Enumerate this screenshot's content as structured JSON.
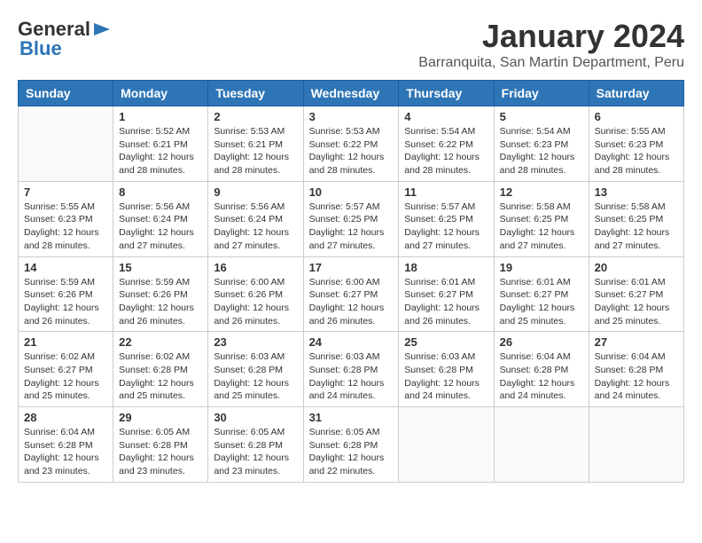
{
  "logo": {
    "general": "General",
    "blue": "Blue"
  },
  "title": "January 2024",
  "location": "Barranquita, San Martin Department, Peru",
  "headers": [
    "Sunday",
    "Monday",
    "Tuesday",
    "Wednesday",
    "Thursday",
    "Friday",
    "Saturday"
  ],
  "weeks": [
    [
      {
        "day": "",
        "info": ""
      },
      {
        "day": "1",
        "info": "Sunrise: 5:52 AM\nSunset: 6:21 PM\nDaylight: 12 hours\nand 28 minutes."
      },
      {
        "day": "2",
        "info": "Sunrise: 5:53 AM\nSunset: 6:21 PM\nDaylight: 12 hours\nand 28 minutes."
      },
      {
        "day": "3",
        "info": "Sunrise: 5:53 AM\nSunset: 6:22 PM\nDaylight: 12 hours\nand 28 minutes."
      },
      {
        "day": "4",
        "info": "Sunrise: 5:54 AM\nSunset: 6:22 PM\nDaylight: 12 hours\nand 28 minutes."
      },
      {
        "day": "5",
        "info": "Sunrise: 5:54 AM\nSunset: 6:23 PM\nDaylight: 12 hours\nand 28 minutes."
      },
      {
        "day": "6",
        "info": "Sunrise: 5:55 AM\nSunset: 6:23 PM\nDaylight: 12 hours\nand 28 minutes."
      }
    ],
    [
      {
        "day": "7",
        "info": "Sunrise: 5:55 AM\nSunset: 6:23 PM\nDaylight: 12 hours\nand 28 minutes."
      },
      {
        "day": "8",
        "info": "Sunrise: 5:56 AM\nSunset: 6:24 PM\nDaylight: 12 hours\nand 27 minutes."
      },
      {
        "day": "9",
        "info": "Sunrise: 5:56 AM\nSunset: 6:24 PM\nDaylight: 12 hours\nand 27 minutes."
      },
      {
        "day": "10",
        "info": "Sunrise: 5:57 AM\nSunset: 6:25 PM\nDaylight: 12 hours\nand 27 minutes."
      },
      {
        "day": "11",
        "info": "Sunrise: 5:57 AM\nSunset: 6:25 PM\nDaylight: 12 hours\nand 27 minutes."
      },
      {
        "day": "12",
        "info": "Sunrise: 5:58 AM\nSunset: 6:25 PM\nDaylight: 12 hours\nand 27 minutes."
      },
      {
        "day": "13",
        "info": "Sunrise: 5:58 AM\nSunset: 6:25 PM\nDaylight: 12 hours\nand 27 minutes."
      }
    ],
    [
      {
        "day": "14",
        "info": "Sunrise: 5:59 AM\nSunset: 6:26 PM\nDaylight: 12 hours\nand 26 minutes."
      },
      {
        "day": "15",
        "info": "Sunrise: 5:59 AM\nSunset: 6:26 PM\nDaylight: 12 hours\nand 26 minutes."
      },
      {
        "day": "16",
        "info": "Sunrise: 6:00 AM\nSunset: 6:26 PM\nDaylight: 12 hours\nand 26 minutes."
      },
      {
        "day": "17",
        "info": "Sunrise: 6:00 AM\nSunset: 6:27 PM\nDaylight: 12 hours\nand 26 minutes."
      },
      {
        "day": "18",
        "info": "Sunrise: 6:01 AM\nSunset: 6:27 PM\nDaylight: 12 hours\nand 26 minutes."
      },
      {
        "day": "19",
        "info": "Sunrise: 6:01 AM\nSunset: 6:27 PM\nDaylight: 12 hours\nand 25 minutes."
      },
      {
        "day": "20",
        "info": "Sunrise: 6:01 AM\nSunset: 6:27 PM\nDaylight: 12 hours\nand 25 minutes."
      }
    ],
    [
      {
        "day": "21",
        "info": "Sunrise: 6:02 AM\nSunset: 6:27 PM\nDaylight: 12 hours\nand 25 minutes."
      },
      {
        "day": "22",
        "info": "Sunrise: 6:02 AM\nSunset: 6:28 PM\nDaylight: 12 hours\nand 25 minutes."
      },
      {
        "day": "23",
        "info": "Sunrise: 6:03 AM\nSunset: 6:28 PM\nDaylight: 12 hours\nand 25 minutes."
      },
      {
        "day": "24",
        "info": "Sunrise: 6:03 AM\nSunset: 6:28 PM\nDaylight: 12 hours\nand 24 minutes."
      },
      {
        "day": "25",
        "info": "Sunrise: 6:03 AM\nSunset: 6:28 PM\nDaylight: 12 hours\nand 24 minutes."
      },
      {
        "day": "26",
        "info": "Sunrise: 6:04 AM\nSunset: 6:28 PM\nDaylight: 12 hours\nand 24 minutes."
      },
      {
        "day": "27",
        "info": "Sunrise: 6:04 AM\nSunset: 6:28 PM\nDaylight: 12 hours\nand 24 minutes."
      }
    ],
    [
      {
        "day": "28",
        "info": "Sunrise: 6:04 AM\nSunset: 6:28 PM\nDaylight: 12 hours\nand 23 minutes."
      },
      {
        "day": "29",
        "info": "Sunrise: 6:05 AM\nSunset: 6:28 PM\nDaylight: 12 hours\nand 23 minutes."
      },
      {
        "day": "30",
        "info": "Sunrise: 6:05 AM\nSunset: 6:28 PM\nDaylight: 12 hours\nand 23 minutes."
      },
      {
        "day": "31",
        "info": "Sunrise: 6:05 AM\nSunset: 6:28 PM\nDaylight: 12 hours\nand 22 minutes."
      },
      {
        "day": "",
        "info": ""
      },
      {
        "day": "",
        "info": ""
      },
      {
        "day": "",
        "info": ""
      }
    ]
  ]
}
